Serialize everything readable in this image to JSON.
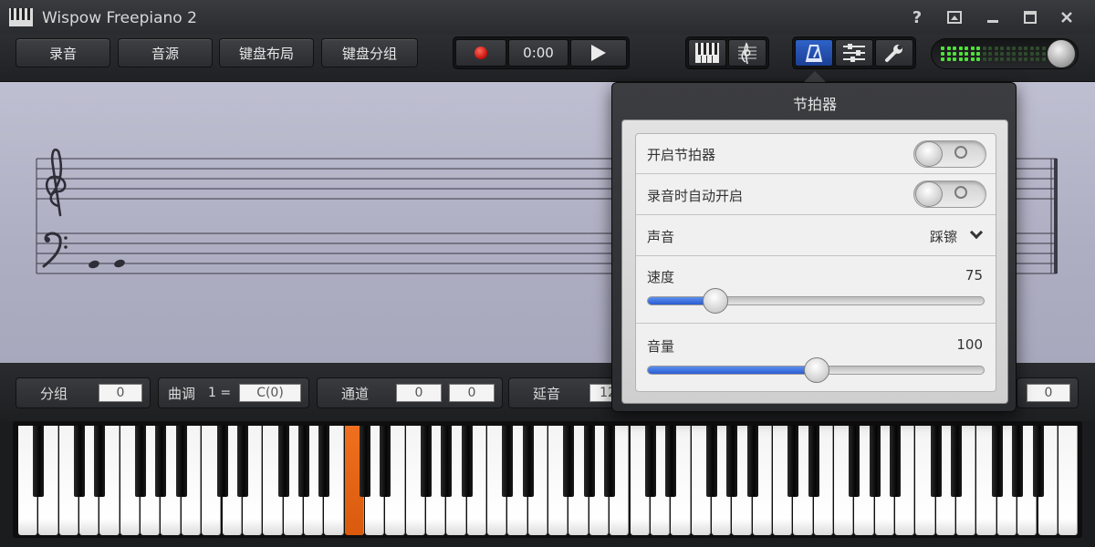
{
  "window": {
    "title": "Wispow Freepiano 2",
    "help_label": "?",
    "icons": [
      "piano-logo-icon",
      "help-icon",
      "mini-mode-icon",
      "minimize-icon",
      "maximize-icon",
      "close-icon"
    ]
  },
  "toolbar": {
    "record_label": "录音",
    "sound_source_label": "音源",
    "keyboard_layout_label": "键盘布局",
    "keyboard_split_label": "键盘分组",
    "time": "0:00",
    "icons": [
      "record-icon",
      "play-icon",
      "keyboard-view-icon",
      "score-view-icon",
      "metronome-icon",
      "settings-sliders-icon",
      "wrench-icon"
    ]
  },
  "status": {
    "group_label": "分组",
    "group_value": "0",
    "key_label": "曲调",
    "key_prefix": "1 =",
    "key_value": "C(0)",
    "channel_label": "通道",
    "channel_value_1": "0",
    "channel_value_2": "0",
    "sustain_label": "延音",
    "sustain_value": "12",
    "last_value": "0"
  },
  "metronome": {
    "title": "节拍器",
    "enable_label": "开启节拍器",
    "enable_on": false,
    "auto_label": "录音时自动开启",
    "auto_on": false,
    "sound_label": "声音",
    "sound_value": "踩镲",
    "speed_label": "速度",
    "speed_value": "75",
    "speed_fraction": 0.2,
    "volume_label": "音量",
    "volume_value": "100",
    "volume_fraction": 0.5
  },
  "keyboard": {
    "pressed_key_color": "#e8650f",
    "accent_color": "#2a5cd2"
  }
}
